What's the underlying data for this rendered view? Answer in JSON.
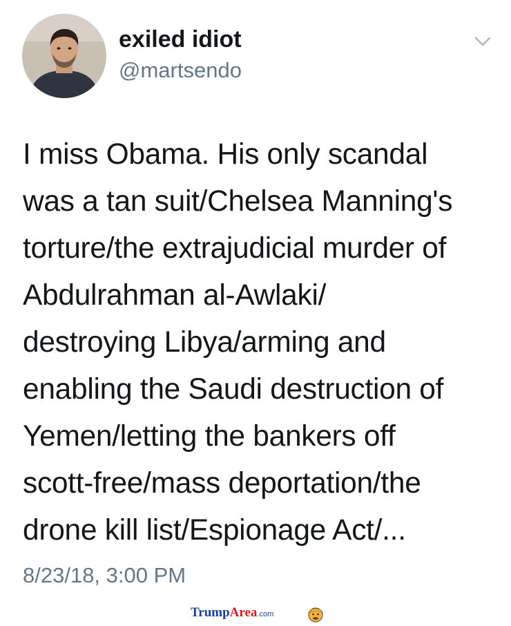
{
  "tweet": {
    "display_name": "exiled idiot",
    "handle": "@martsendo",
    "text_lines": [
      "I miss Obama. His only scandal",
      "was a tan suit/Chelsea Manning's",
      "torture/the extrajudicial murder of",
      "Abdulrahman al-Awlaki/",
      "destroying Libya/arming and",
      "enabling the Saudi destruction of",
      "Yemen/letting the bankers off",
      "scott-free/mass deportation/the",
      "drone kill list/Espionage Act/..."
    ],
    "timestamp": "8/23/18, 3:00 PM",
    "menu_icon": "chevron-down-icon"
  },
  "watermark": {
    "part1": "Trump",
    "part2": "Area",
    "part3": ".com",
    "icon": "trump-face-icon"
  },
  "colors": {
    "text": "#14171a",
    "secondary": "#657786",
    "watermark_blue": "#1a3fa0",
    "watermark_red": "#d21f1f"
  }
}
